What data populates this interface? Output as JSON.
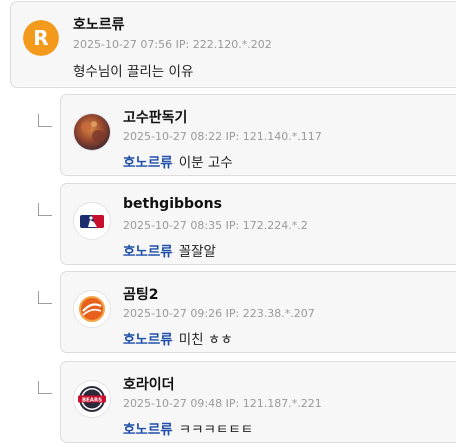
{
  "parent": {
    "author": "호노르류",
    "avatar_letter": "R",
    "timestamp": "2025-10-27 07:56",
    "ip_label": "IP:",
    "ip": "222.120.*.202",
    "text": "형수님이 끌리는 이유"
  },
  "replies": [
    {
      "author": "고수판독기",
      "timestamp": "2025-10-27 08:22",
      "ip_label": "IP:",
      "ip": "121.140.*.117",
      "mention": "호노르류",
      "text": "이분 고수"
    },
    {
      "author": "bethgibbons",
      "timestamp": "2025-10-27 08:35",
      "ip_label": "IP:",
      "ip": "172.224.*.2",
      "mention": "호노르류",
      "text": "꼴잘알"
    },
    {
      "author": "곰팅2",
      "timestamp": "2025-10-27 09:26",
      "ip_label": "IP:",
      "ip": "223.38.*.207",
      "mention": "호노르류",
      "text": "미친 ㅎㅎ"
    },
    {
      "author": "호라이더",
      "timestamp": "2025-10-27 09:48",
      "ip_label": "IP:",
      "ip": "121.187.*.221",
      "mention": "호노르류",
      "text": "ㅋㅋㅋㅌㅌㅌ"
    }
  ],
  "logo_text": {
    "bears": "BEARS"
  },
  "colors": {
    "accent_orange": "#f39a1c",
    "mention_blue": "#1f4fa8",
    "card_bg": "#f7f7f8",
    "card_border": "#dcdcdc"
  }
}
